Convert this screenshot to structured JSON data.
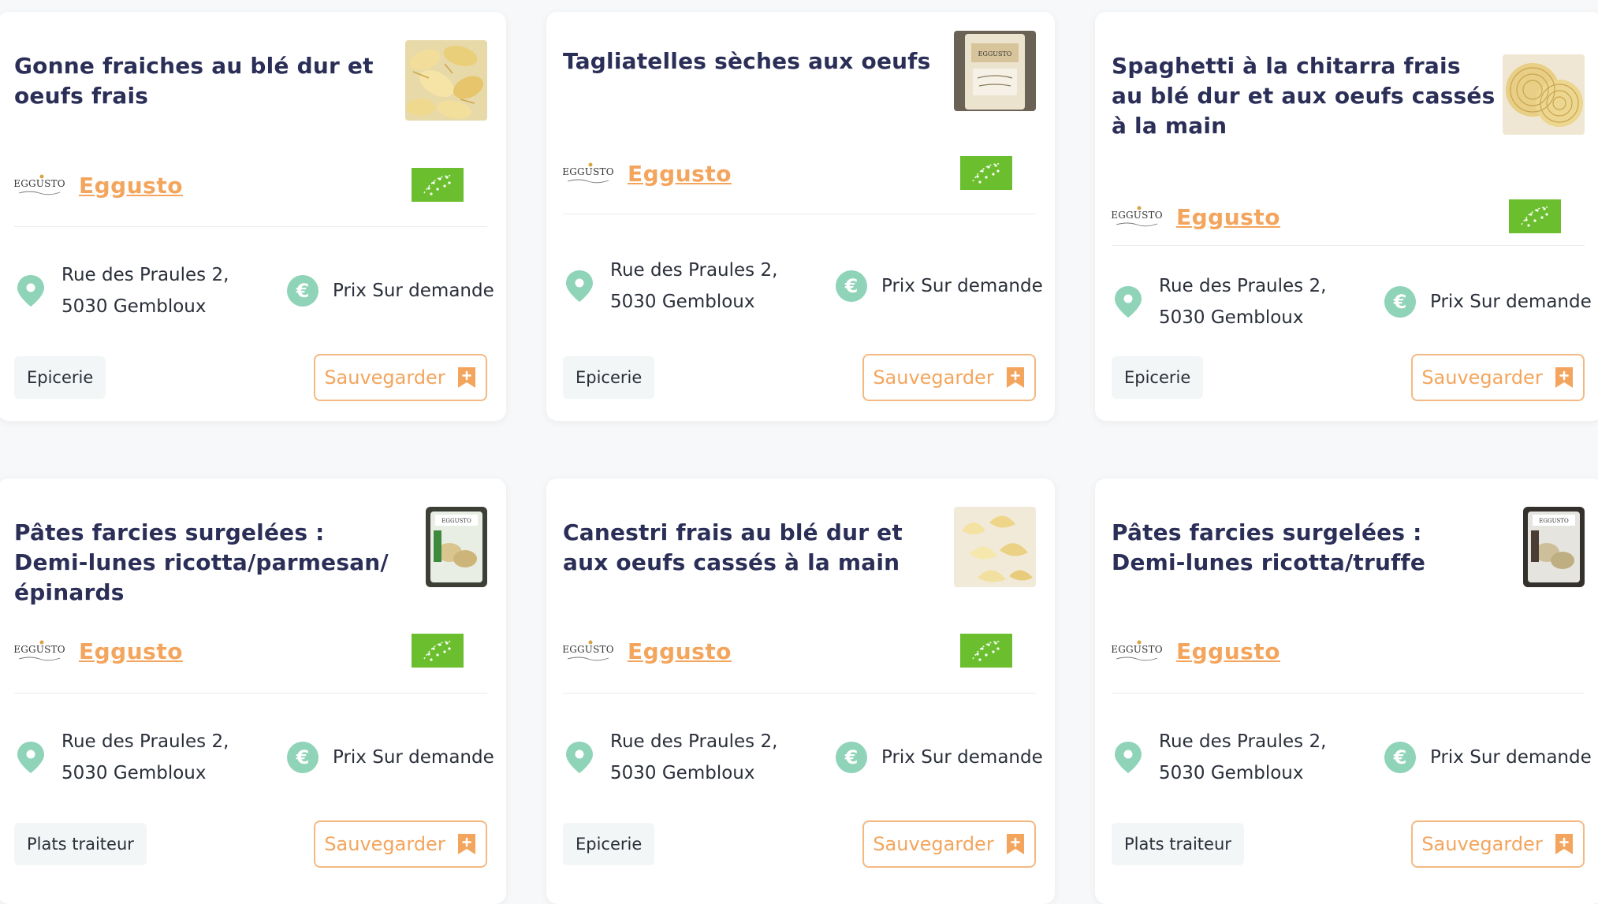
{
  "colors": {
    "title": "#2b2f57",
    "accent": "#f4a55d",
    "bio_green": "#6bbf2f",
    "mint": "#8fd3b9"
  },
  "products": [
    {
      "title": "Gonne fraiches au blé dur et oeufs frais",
      "image": "pasta-gonne",
      "producer_logo": "EGGUSTO",
      "producer": "Eggusto",
      "bio": true,
      "address_line1": "Rue des Praules 2,",
      "address_line2": "5030 Gembloux",
      "price": "Prix Sur demande",
      "category": "Epicerie",
      "save_label": "Sauvegarder"
    },
    {
      "title": "Tagliatelles sèches aux oeufs",
      "image": "pasta-tagliatelle-pack",
      "producer_logo": "EGGUSTO",
      "producer": "Eggusto",
      "bio": true,
      "address_line1": "Rue des Praules 2,",
      "address_line2": "5030 Gembloux",
      "price": "Prix Sur demande",
      "category": "Epicerie",
      "save_label": "Sauvegarder"
    },
    {
      "title": "Spaghetti à la chitarra frais au blé dur et aux oeufs cassés à la main",
      "image": "pasta-spaghetti-nests",
      "producer_logo": "EGGUSTO",
      "producer": "Eggusto",
      "bio": true,
      "address_line1": "Rue des Praules 2,",
      "address_line2": "5030 Gembloux",
      "price": "Prix Sur demande",
      "category": "Epicerie",
      "save_label": "Sauvegarder"
    },
    {
      "title": "Pâtes farcies surgelées : Demi-lunes ricotta/parmesan/épinards",
      "image": "pasta-demi-lunes-pack",
      "producer_logo": "EGGUSTO",
      "producer": "Eggusto",
      "bio": true,
      "address_line1": "Rue des Praules 2,",
      "address_line2": "5030 Gembloux",
      "price": "Prix Sur demande",
      "category": "Plats traiteur",
      "save_label": "Sauvegarder"
    },
    {
      "title": "Canestri frais au blé dur et aux oeufs cassés à la main",
      "image": "pasta-canestri",
      "producer_logo": "EGGUSTO",
      "producer": "Eggusto",
      "bio": true,
      "address_line1": "Rue des Praules 2,",
      "address_line2": "5030 Gembloux",
      "price": "Prix Sur demande",
      "category": "Epicerie",
      "save_label": "Sauvegarder"
    },
    {
      "title": "Pâtes farcies surgelées : Demi-lunes ricotta/truffe",
      "image": "pasta-demi-lunes-truffe-pack",
      "producer_logo": "EGGUSTO",
      "producer": "Eggusto",
      "bio": false,
      "address_line1": "Rue des Praules 2,",
      "address_line2": "5030 Gembloux",
      "price": "Prix Sur demande",
      "category": "Plats traiteur",
      "save_label": "Sauvegarder"
    }
  ]
}
